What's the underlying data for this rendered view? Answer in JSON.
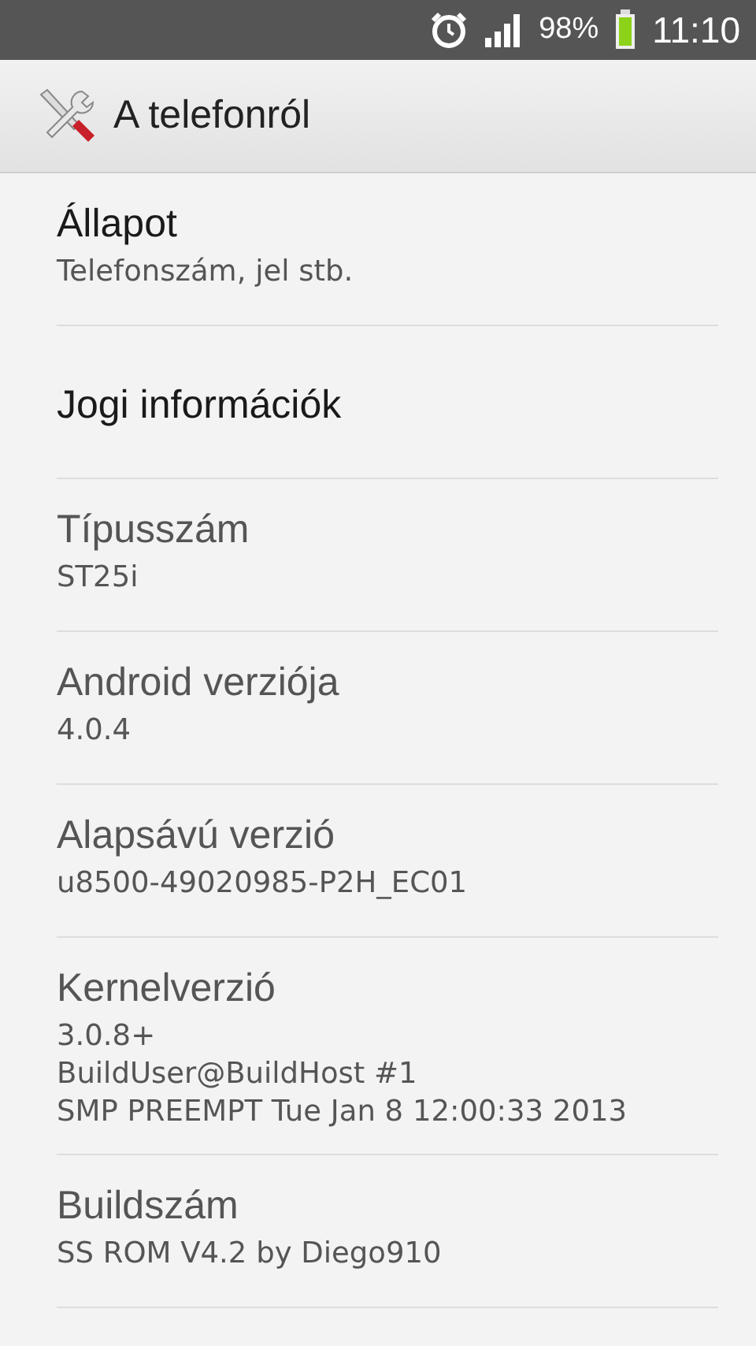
{
  "status_bar": {
    "battery": "98%",
    "time": "11:10"
  },
  "action_bar": {
    "title": "A telefonról"
  },
  "items": [
    {
      "title": "Állapot",
      "summary": [
        "Telefonszám, jel stb."
      ],
      "disabled": false
    },
    {
      "title": "Jogi információk",
      "disabled": false
    },
    {
      "title": "Típusszám",
      "summary": [
        "ST25i"
      ],
      "disabled": true
    },
    {
      "title": "Android verziója",
      "summary": [
        "4.0.4"
      ],
      "disabled": true
    },
    {
      "title": "Alapsávú verzió",
      "summary": [
        "u8500-49020985-P2H_EC01"
      ],
      "disabled": true
    },
    {
      "title": "Kernelverzió",
      "summary": [
        "3.0.8+",
        "BuildUser@BuildHost #1",
        "SMP PREEMPT Tue Jan 8 12:00:33 2013"
      ],
      "disabled": true
    },
    {
      "title": "Buildszám",
      "summary": [
        "SS ROM V4.2 by Diego910"
      ],
      "disabled": true
    }
  ]
}
